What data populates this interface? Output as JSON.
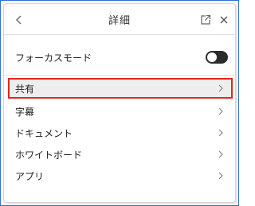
{
  "header": {
    "title": "詳細"
  },
  "focus_mode": {
    "label": "フォーカスモード",
    "enabled": false
  },
  "menu": {
    "items": [
      {
        "label": "共有",
        "highlighted": true
      },
      {
        "label": "字幕",
        "highlighted": false
      },
      {
        "label": "ドキュメント",
        "highlighted": false
      },
      {
        "label": "ホワイトボード",
        "highlighted": false
      },
      {
        "label": "アプリ",
        "highlighted": false
      }
    ]
  },
  "colors": {
    "highlight_border": "#e8241a",
    "toggle_track": "#2b2b2b",
    "frame_border": "#2f6fd0"
  },
  "icons": {
    "back": "chevron-left-icon",
    "popout": "open-in-new-window-icon",
    "close": "close-icon",
    "item_chevron": "chevron-right-icon"
  }
}
